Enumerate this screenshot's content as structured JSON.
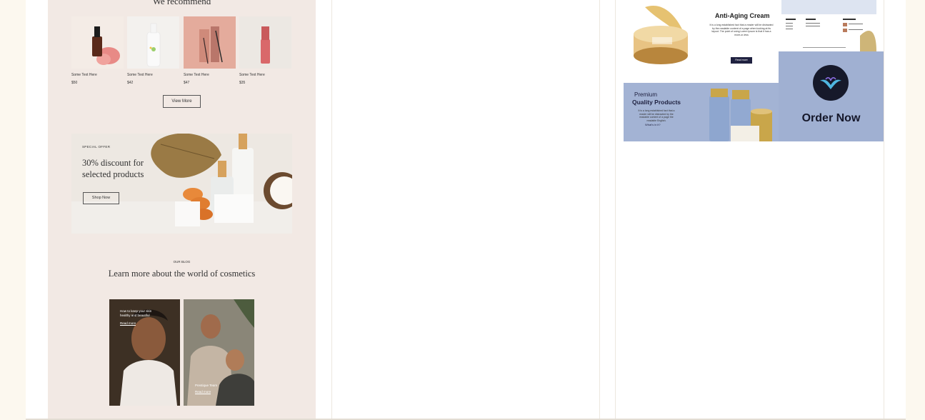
{
  "recommend": {
    "heading": "We recommend",
    "products": [
      {
        "name": "Some Text Here",
        "price": "$50"
      },
      {
        "name": "Some Text Here",
        "price": "$42"
      },
      {
        "name": "Some Text Here",
        "price": "$47"
      },
      {
        "name": "Some Text Here",
        "price": "$35"
      }
    ],
    "view_more": "View More"
  },
  "offer": {
    "tag": "SPECIAL OFFER",
    "title": "30% discount for selected products",
    "button": "Shop Now"
  },
  "blog": {
    "tag": "OUR BLOG",
    "title": "Learn more about the world of cosmetics",
    "cards": [
      {
        "caption": "How to keep your skin healthy and beautiful",
        "link": "Read more"
      },
      {
        "caption": "Prestique Team",
        "link": "Read more"
      }
    ]
  },
  "ad": {
    "title": "Anti-Aging Cream",
    "text": "It is a long established fact that a reader will be distracted by the readable content of a page when looking at its layout. The point of using Lorem Ipsum is that it has a more-or-less",
    "text2": "It is a long established fact that a reader will be distracted by the readable content of a page when looking at its layout. The point of",
    "read_more": "Read more",
    "premium": "Premium",
    "quality": "Quality Products",
    "premium_text": "It is a long established fact that a reader will be distracted by the readable content of a page the readable English.",
    "whats": "What's in it?",
    "order": "Order Now"
  },
  "colors": {
    "page_bg": "#fcf8ef",
    "left_col_bg": "#f2e9e4",
    "ad_blue": "#a3b3d4",
    "navy": "#1f2140"
  }
}
